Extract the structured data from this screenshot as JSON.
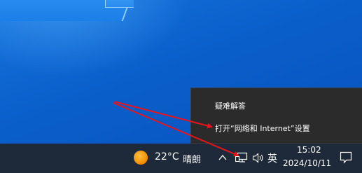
{
  "context_menu": {
    "items": [
      {
        "label": "疑难解答"
      },
      {
        "label": "打开“网络和 Internet”设置"
      }
    ]
  },
  "taskbar": {
    "weather": {
      "temperature": "22°C",
      "condition": "晴朗",
      "icon": "sun-icon"
    },
    "tray_icons": [
      "chevron-up-icon",
      "network-icon",
      "volume-icon"
    ],
    "ime": "英",
    "clock": {
      "time": "15:02",
      "date": "2024/10/11"
    },
    "notification_icon": "notification-icon"
  },
  "annotations": {
    "arrow_color": "#e8141c"
  },
  "colors": {
    "taskbar": "#1e2a3a",
    "menu_bg": "#2b2b2b",
    "desktop": "#0a63cf",
    "weather_sun": "#f59a0a"
  }
}
